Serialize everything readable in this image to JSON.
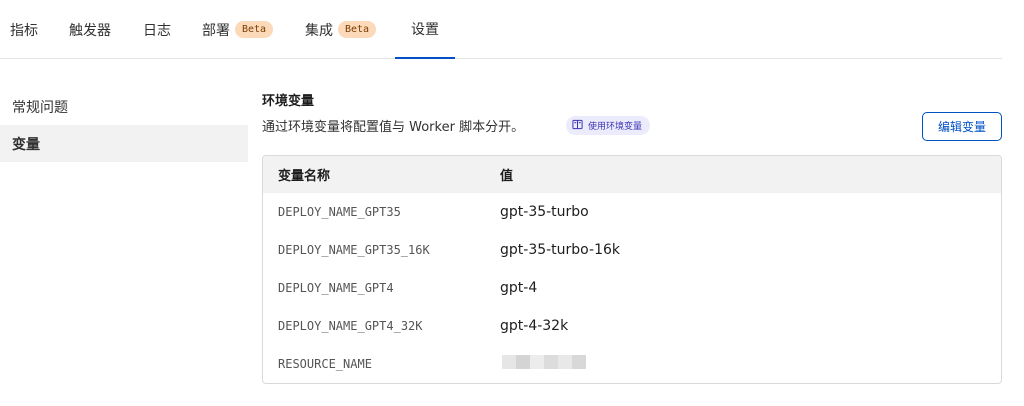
{
  "tabs": [
    {
      "label": "指标",
      "badge": ""
    },
    {
      "label": "触发器",
      "badge": ""
    },
    {
      "label": "日志",
      "badge": ""
    },
    {
      "label": "部署",
      "badge": "Beta"
    },
    {
      "label": "集成",
      "badge": "Beta"
    },
    {
      "label": "设置",
      "badge": ""
    }
  ],
  "active_tab": "设置",
  "sidebar": {
    "items": [
      {
        "label": "常规问题"
      },
      {
        "label": "变量"
      }
    ],
    "active": "变量"
  },
  "section": {
    "title": "环境变量",
    "description": "通过环境变量将配置值与 Worker 脚本分开。",
    "doc_link_label": "使用环境变量",
    "edit_button_label": "编辑变量"
  },
  "table": {
    "headers": [
      "变量名称",
      "值"
    ],
    "rows": [
      {
        "name": "DEPLOY_NAME_GPT35",
        "value": "gpt-35-turbo"
      },
      {
        "name": "DEPLOY_NAME_GPT35_16K",
        "value": "gpt-35-turbo-16k"
      },
      {
        "name": "DEPLOY_NAME_GPT4",
        "value": "gpt-4"
      },
      {
        "name": "DEPLOY_NAME_GPT4_32K",
        "value": "gpt-4-32k"
      },
      {
        "name": "RESOURCE_NAME",
        "value": ""
      }
    ]
  },
  "colors": {
    "accent": "#0051c3",
    "badge_bg": "#fcd9b8",
    "link_bg": "#ecebfb",
    "link_text": "#3c34b5"
  },
  "icons": {
    "doc_link": "book-icon"
  }
}
